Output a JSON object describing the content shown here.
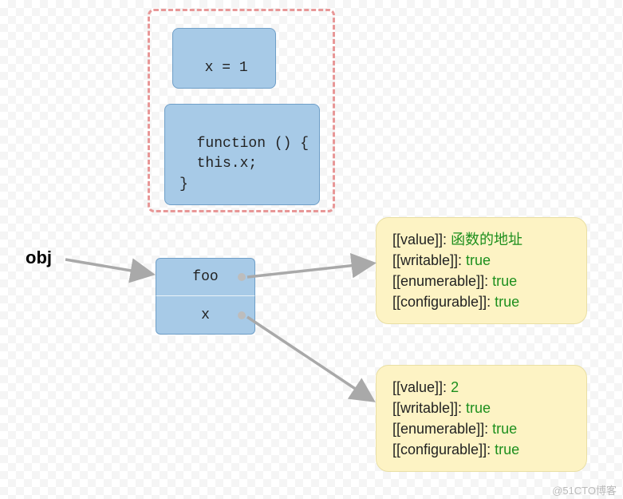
{
  "label_obj": "obj",
  "box_x_assign": "x = 1",
  "box_function": "function () {\n  this.x;\n}",
  "prop_foo": "foo",
  "prop_x": "x",
  "descriptor_foo": {
    "value_label": "[[value]]:",
    "value_value": "函数的地址",
    "writable_label": "[[writable]]:",
    "writable_value": "true",
    "enumerable_label": "[[enumerable]]:",
    "enumerable_value": "true",
    "configurable_label": "[[configurable]]:",
    "configurable_value": "true"
  },
  "descriptor_x": {
    "value_label": "[[value]]:",
    "value_value": "2",
    "writable_label": "[[writable]]:",
    "writable_value": "true",
    "enumerable_label": "[[enumerable]]:",
    "enumerable_value": "true",
    "configurable_label": "[[configurable]]:",
    "configurable_value": "true"
  },
  "watermark": "@51CTO博客"
}
